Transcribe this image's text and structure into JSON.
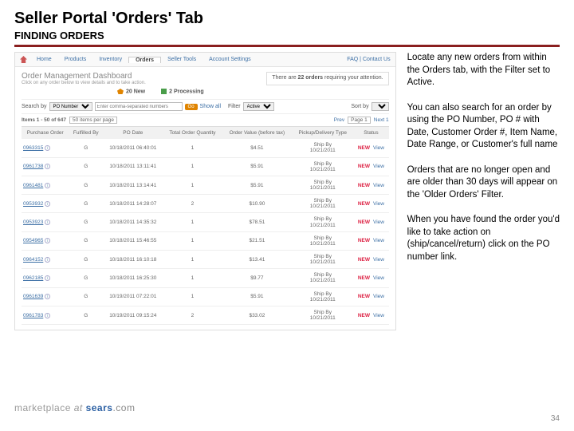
{
  "slide": {
    "title": "Seller Portal 'Orders' Tab",
    "subtitle": "FINDING ORDERS",
    "page_num": "34"
  },
  "nav": {
    "tabs": [
      "Home",
      "Products",
      "Inventory",
      "Orders",
      "Seller Tools",
      "Account Settings"
    ],
    "right": "FAQ | Contact Us"
  },
  "dash": {
    "title": "Order Management Dashboard",
    "sub": "Click on any order below to view details and to take action.",
    "attention_a": "There are ",
    "attention_b": "22 orders",
    "attention_c": " requiring your attention.",
    "new_badge": "20 New",
    "proc_badge": "2 Processing"
  },
  "search": {
    "label": "Search by",
    "by_value": "PO Number",
    "placeholder": "Enter comma-separated numbers",
    "go": "Go",
    "showall": "Show all",
    "filter_label": "Filter",
    "filter_value": "Active",
    "sortby": "Sort by"
  },
  "pager": {
    "items": "Items 1 - 50 of 647",
    "perpage": "50 items per page",
    "prev": "Prev",
    "page": "Page 1",
    "next": "Next 1"
  },
  "cols": [
    "Purchase Order",
    "Fulfilled By",
    "PO Date",
    "Total Order Quantity",
    "Order Value (before tax)",
    "Pickup/Delivery Type",
    "Status"
  ],
  "rows": [
    {
      "po": "0963315",
      "by": "G",
      "date": "10/18/2011 06:40:01",
      "qty": "1",
      "val": "$4.51",
      "pick": "Ship By\n10/21/2011",
      "st": "New"
    },
    {
      "po": "0961738",
      "by": "G",
      "date": "10/18/2011 13:11:41",
      "qty": "1",
      "val": "$5.91",
      "pick": "Ship By\n10/21/2011",
      "st": "New"
    },
    {
      "po": "0961481",
      "by": "G",
      "date": "10/18/2011 13:14:41",
      "qty": "1",
      "val": "$5.91",
      "pick": "Ship By\n10/21/2011",
      "st": "New"
    },
    {
      "po": "0953932",
      "by": "G",
      "date": "10/18/2011 14:28:07",
      "qty": "2",
      "val": "$10.90",
      "pick": "Ship By\n10/21/2011",
      "st": "New"
    },
    {
      "po": "0953923",
      "by": "G",
      "date": "10/18/2011 14:35:32",
      "qty": "1",
      "val": "$78.51",
      "pick": "Ship By\n10/21/2011",
      "st": "New"
    },
    {
      "po": "0954965",
      "by": "G",
      "date": "10/18/2011 15:46:55",
      "qty": "1",
      "val": "$21.51",
      "pick": "Ship By\n10/21/2011",
      "st": "New"
    },
    {
      "po": "0964152",
      "by": "G",
      "date": "10/18/2011 16:10:18",
      "qty": "1",
      "val": "$13.41",
      "pick": "Ship By\n10/21/2011",
      "st": "New"
    },
    {
      "po": "0962185",
      "by": "G",
      "date": "10/18/2011 16:25:30",
      "qty": "1",
      "val": "$9.77",
      "pick": "Ship By\n10/21/2011",
      "st": "New"
    },
    {
      "po": "0961639",
      "by": "G",
      "date": "10/19/2011 07:22:01",
      "qty": "1",
      "val": "$5.91",
      "pick": "Ship By\n10/21/2011",
      "st": "New"
    },
    {
      "po": "0961783",
      "by": "G",
      "date": "10/19/2011 09:15:24",
      "qty": "2",
      "val": "$33.02",
      "pick": "Ship By\n10/21/2011",
      "st": "New"
    }
  ],
  "notes": {
    "p1": "Locate any new orders from within the Orders tab, with the Filter set to Active.",
    "p2": "You can also search for an order by using the PO Number, PO # with Date, Customer Order #, Item Name, Date Range, or Customer's full name",
    "p3": "Orders that are no longer open and are older than 30 days will appear on the 'Older Orders' Filter.",
    "p4": "When you have found the order you'd like to take action on (ship/cancel/return) click on the PO number link."
  },
  "brand": {
    "mp": "marketplace",
    "at": " at ",
    "sears": "sears",
    "com": ".com"
  },
  "lbl": {
    "new_status": "NEW",
    "view": "View"
  }
}
